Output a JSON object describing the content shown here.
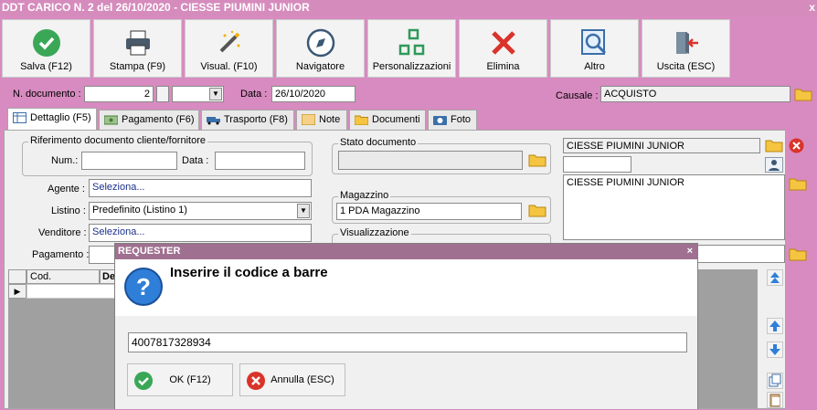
{
  "window": {
    "title": "DDT CARICO N. 2 del 26/10/2020 - CIESSE PIUMINI JUNIOR",
    "close": "x"
  },
  "toolbar": [
    {
      "label": "Salva (F12)",
      "icon": "check-icon"
    },
    {
      "label": "Stampa (F9)",
      "icon": "printer-icon"
    },
    {
      "label": "Visual. (F10)",
      "icon": "magic-wand-icon"
    },
    {
      "label": "Navigatore",
      "icon": "compass-icon"
    },
    {
      "label": "Personalizzazioni",
      "icon": "grid-icon"
    },
    {
      "label": "Elimina",
      "icon": "delete-x-icon"
    },
    {
      "label": "Altro",
      "icon": "magnifier-icon"
    },
    {
      "label": "Uscita (ESC)",
      "icon": "exit-door-icon"
    }
  ],
  "header": {
    "ndoc_label": "N. documento :",
    "ndoc_value": "2",
    "data_label": "Data :",
    "data_value": "26/10/2020",
    "causale_label": "Causale :",
    "causale_value": "ACQUISTO"
  },
  "tabs": [
    "Dettaglio (F5)",
    "Pagamento (F6)",
    "Trasporto (F8)",
    "Note",
    "Documenti",
    "Foto"
  ],
  "dettaglio": {
    "rif_group": "Riferimento documento cliente/fornitore",
    "num_label": "Num.:",
    "data_label": "Data :",
    "agente_label": "Agente :",
    "agente_value": "Seleziona...",
    "listino_label": "Listino :",
    "listino_value": "Predefinito (Listino 1)",
    "venditore_label": "Venditore :",
    "venditore_value": "Seleziona...",
    "pagamento_label": "Pagamento :",
    "stato_group": "Stato documento",
    "magazzino_group": "Magazzino",
    "magazzino_value": "1 PDA Magazzino",
    "visual_group": "Visualizzazione",
    "cliente_name": "CIESSE PIUMINI JUNIOR",
    "cliente_address": "CIESSE PIUMINI JUNIOR",
    "grid_col_cod": "Cod.",
    "grid_col_de": "De"
  },
  "dialog": {
    "title": "REQUESTER",
    "close": "×",
    "message": "Inserire il codice a barre",
    "input_value": "4007817328934",
    "ok_label": "OK (F12)",
    "cancel_label": "Annulla (ESC)"
  },
  "colors": {
    "background": "#d88bc0",
    "dialog_title": "#a07090",
    "folder": "#f5c542",
    "ok": "#3aa757",
    "cancel": "#d9332a"
  }
}
